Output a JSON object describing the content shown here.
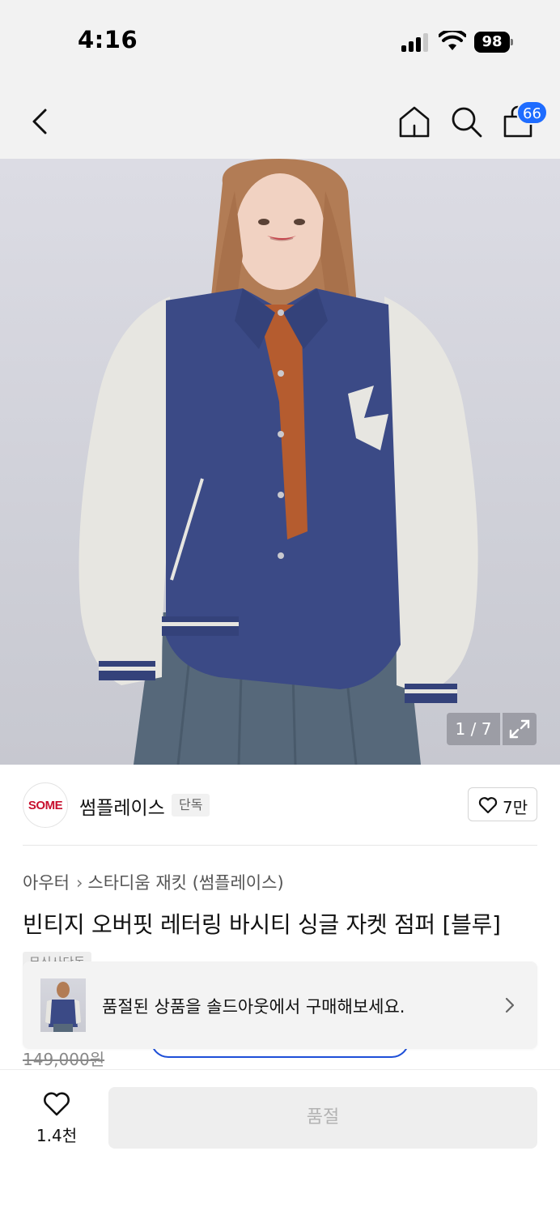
{
  "status_bar": {
    "time": "4:16",
    "battery": "98"
  },
  "nav": {
    "cart_badge": "66",
    "icons": [
      "chevron-left-icon",
      "home-icon",
      "search-icon",
      "shopping-bag-icon"
    ]
  },
  "image": {
    "counter": "1 / 7",
    "expand_icon": "expand-icon"
  },
  "brand": {
    "logo_text": "SOME",
    "name": "썸플레이스",
    "tag": "단독",
    "likes": "7만"
  },
  "breadcrumb": {
    "category": "아우터",
    "subcategory": "스타디움 재킷 (썸플레이스)"
  },
  "product": {
    "title": "빈티지 오버핏 레터링 바시티 싱글 자켓 점퍼 [블루]",
    "hidden_tag": "무신사단독",
    "original_price": "149,000원"
  },
  "soldout_banner": {
    "text": "품절된 상품을 솔드아웃에서 구매해보세요."
  },
  "bottom_bar": {
    "wish_count": "1.4천",
    "action_label": "품절"
  },
  "colors": {
    "accent": "#1e6cff",
    "brand_red": "#c8102e",
    "jacket_navy": "#3b4a86"
  }
}
